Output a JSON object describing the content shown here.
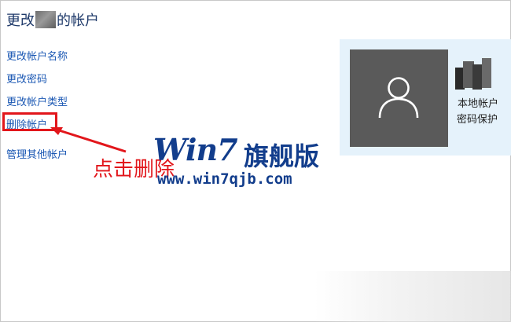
{
  "page": {
    "title_prefix": "更改",
    "title_suffix": "的帐户"
  },
  "links": {
    "rename": "更改帐户名称",
    "password": "更改密码",
    "type": "更改帐户类型",
    "delete": "删除帐户",
    "manage": "管理其他帐户"
  },
  "annotation": {
    "text": "点击删除",
    "color": "#e2161b"
  },
  "account": {
    "avatar_icon": "user-silhouette-icon",
    "type": "本地帐户",
    "password_state": "密码保护"
  },
  "watermark": {
    "brand": "Win7",
    "flagship": "旗舰版",
    "url": "www.win7qjb.com",
    "color": "#123d8c"
  },
  "colors": {
    "link": "#1a57b3",
    "title": "#1f3a6a",
    "panel_bg": "#e5f2fb",
    "avatar_bg": "#5a5a5a"
  }
}
